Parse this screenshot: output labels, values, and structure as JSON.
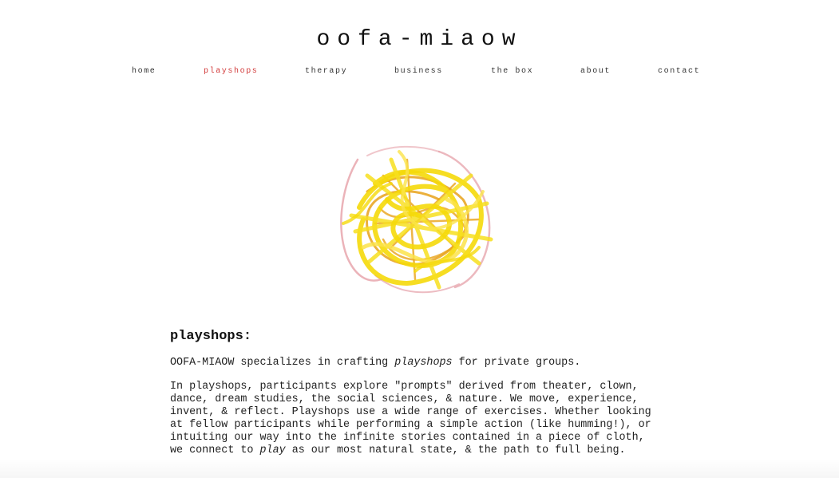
{
  "site": {
    "title": "oofa-miaow"
  },
  "nav": {
    "items": [
      {
        "label": "home",
        "active": false
      },
      {
        "label": "playshops",
        "active": true
      },
      {
        "label": "therapy",
        "active": false
      },
      {
        "label": "business",
        "active": false
      },
      {
        "label": "the box",
        "active": false
      },
      {
        "label": "about",
        "active": false
      },
      {
        "label": "contact",
        "active": false
      }
    ]
  },
  "hero": {
    "icon": "yellow-scribble-drawing"
  },
  "content": {
    "heading": "playshops:",
    "intro": {
      "before": "OOFA-MIAOW specializes in crafting ",
      "emphasis": "playshops",
      "after": " for private groups."
    },
    "body": {
      "before": "In playshops, participants explore \"prompts\" derived from theater, clown, dance, dream studies, the social sciences, & nature. We move, experience, invent, & reflect. Playshops use a wide range of exercises. Whether looking at fellow participants while performing a simple action (like humming!), or intuiting our way into the infinite stories contained in a piece of cloth, we connect to ",
      "emphasis": "play",
      "after": " as our most natural state, & the path to full being."
    }
  },
  "colors": {
    "active_nav": "#d23a3a",
    "text": "#222222",
    "scribble_yellow": "#f5d90a",
    "scribble_orange": "#e8a21a",
    "scribble_pink": "#e6a0a8"
  }
}
